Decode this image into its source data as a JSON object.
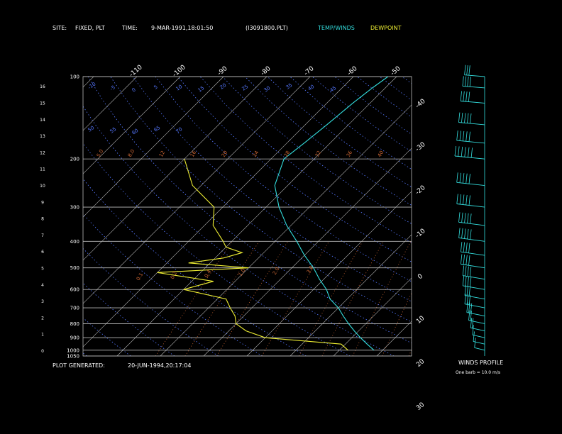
{
  "header": {
    "site_label": "SITE:",
    "site_value": "FIXED, PLT",
    "time_label": "TIME:",
    "time_value": "9-MAR-1991,18:01:50",
    "file": "(I3091800.PLT)",
    "legend_temp": "TEMP/WINDS",
    "legend_dew": "DEWPOINT"
  },
  "footer": {
    "generated_label": "PLOT GENERATED:",
    "generated_value": "20-JUN-1994,20:17:04"
  },
  "winds_panel": {
    "title": "WINDS PROFILE",
    "note": "One barb = 10.0 m/s"
  },
  "colors": {
    "temp": "#33dddd",
    "dew": "#eeee33",
    "grid": "#bbbbbb",
    "dry_adiabat": "#5577ff",
    "mixing_ratio": "#cc6633",
    "text": "#ffffff"
  },
  "chart_data": {
    "type": "line",
    "title": "",
    "pressure_ticks": [
      "100",
      "200",
      "300",
      "400",
      "500",
      "600",
      "700",
      "800",
      "900",
      "1000",
      "1050"
    ],
    "height_ticks": [
      "0",
      "1",
      "2",
      "3",
      "4",
      "5",
      "6",
      "7",
      "8",
      "9",
      "10",
      "11",
      "12",
      "13",
      "14",
      "15",
      "16"
    ],
    "temperature_isotherm_labels": [
      "-110",
      "-100",
      "-90",
      "-80",
      "-70",
      "-60",
      "-50",
      "-40",
      "-30",
      "-20",
      "-10",
      "0",
      "10",
      "20",
      "30"
    ],
    "dry_adiabat_labels": [
      "-10",
      "-5",
      "0",
      "5",
      "10",
      "15",
      "20",
      "25",
      "30",
      "35",
      "40",
      "45",
      "50",
      "55",
      "60",
      "65",
      "70"
    ],
    "mixing_ratio_labels": [
      "0.1",
      "0.2",
      "0.4",
      "1.0",
      "2.0",
      "3.0",
      "5.0",
      "8.0",
      "12",
      "16",
      "20",
      "24",
      "28",
      "32",
      "36",
      "40"
    ],
    "series": [
      {
        "name": "TEMP/WINDS",
        "points": [
          [
            1000,
            8
          ],
          [
            950,
            5
          ],
          [
            900,
            2
          ],
          [
            850,
            -1
          ],
          [
            800,
            -4
          ],
          [
            750,
            -7
          ],
          [
            700,
            -10
          ],
          [
            650,
            -14
          ],
          [
            600,
            -17
          ],
          [
            550,
            -21
          ],
          [
            500,
            -25
          ],
          [
            450,
            -30
          ],
          [
            400,
            -35
          ],
          [
            350,
            -41
          ],
          [
            300,
            -47
          ],
          [
            250,
            -53
          ],
          [
            200,
            -57
          ],
          [
            175,
            -56
          ],
          [
            150,
            -55
          ],
          [
            125,
            -54
          ],
          [
            110,
            -53
          ],
          [
            100,
            -52
          ]
        ]
      },
      {
        "name": "DEWPOINT",
        "points": [
          [
            1000,
            2
          ],
          [
            950,
            -1
          ],
          [
            900,
            -20
          ],
          [
            850,
            -26
          ],
          [
            800,
            -30
          ],
          [
            750,
            -32
          ],
          [
            700,
            -35
          ],
          [
            650,
            -38
          ],
          [
            600,
            -50
          ],
          [
            560,
            -45
          ],
          [
            520,
            -60
          ],
          [
            500,
            -40
          ],
          [
            480,
            -55
          ],
          [
            460,
            -48
          ],
          [
            440,
            -45
          ],
          [
            420,
            -50
          ],
          [
            400,
            -52
          ],
          [
            350,
            -58
          ],
          [
            300,
            -62
          ],
          [
            250,
            -72
          ],
          [
            200,
            -80
          ]
        ]
      }
    ],
    "winds": [
      {
        "p": 1000,
        "speed": 5
      },
      {
        "p": 950,
        "speed": 8
      },
      {
        "p": 900,
        "speed": 10
      },
      {
        "p": 850,
        "speed": 15
      },
      {
        "p": 800,
        "speed": 20
      },
      {
        "p": 750,
        "speed": 25
      },
      {
        "p": 700,
        "speed": 30
      },
      {
        "p": 650,
        "speed": 30
      },
      {
        "p": 600,
        "speed": 35
      },
      {
        "p": 550,
        "speed": 35
      },
      {
        "p": 500,
        "speed": 40
      },
      {
        "p": 450,
        "speed": 40
      },
      {
        "p": 400,
        "speed": 45
      },
      {
        "p": 350,
        "speed": 45
      },
      {
        "p": 300,
        "speed": 50
      },
      {
        "p": 250,
        "speed": 50
      },
      {
        "p": 200,
        "speed": 55
      },
      {
        "p": 175,
        "speed": 50
      },
      {
        "p": 150,
        "speed": 45
      },
      {
        "p": 125,
        "speed": 40
      },
      {
        "p": 110,
        "speed": 35
      },
      {
        "p": 100,
        "speed": 30
      }
    ]
  }
}
